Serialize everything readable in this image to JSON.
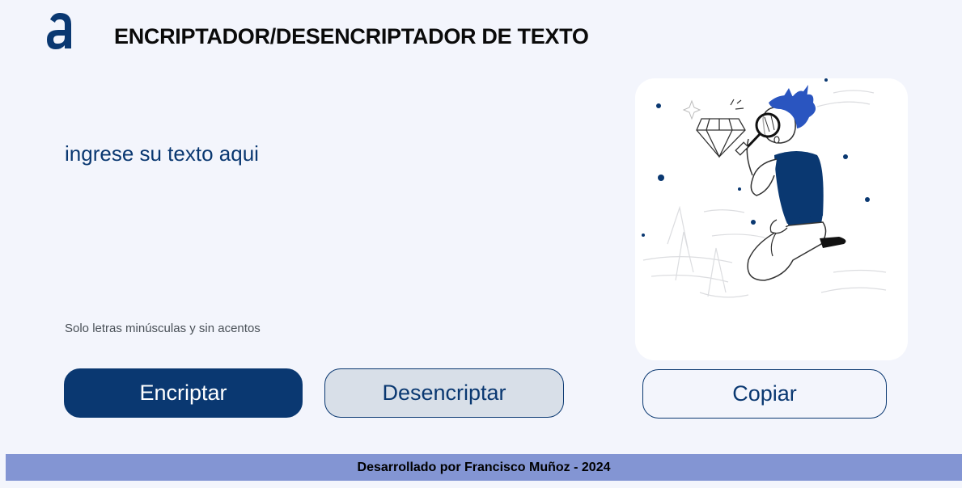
{
  "header": {
    "logo_letter": "a",
    "title": "ENCRIPTADOR/DESENCRIPTADOR DE TEXTO"
  },
  "input": {
    "placeholder": "ingrese su texto aqui",
    "value": ""
  },
  "hint": "Solo letras minúsculas y sin acentos",
  "buttons": {
    "encrypt": "Encriptar",
    "decrypt": "Desencriptar",
    "copy": "Copiar"
  },
  "output": {
    "illustration": "person-with-magnifying-glass-illustration"
  },
  "footer": {
    "text": "Desarrollado por Francisco Muñoz - 2024"
  },
  "colors": {
    "primary": "#0a3871",
    "background": "#f3f5fc",
    "secondary_button": "#d8dfe8",
    "footer": "#8395d3"
  }
}
